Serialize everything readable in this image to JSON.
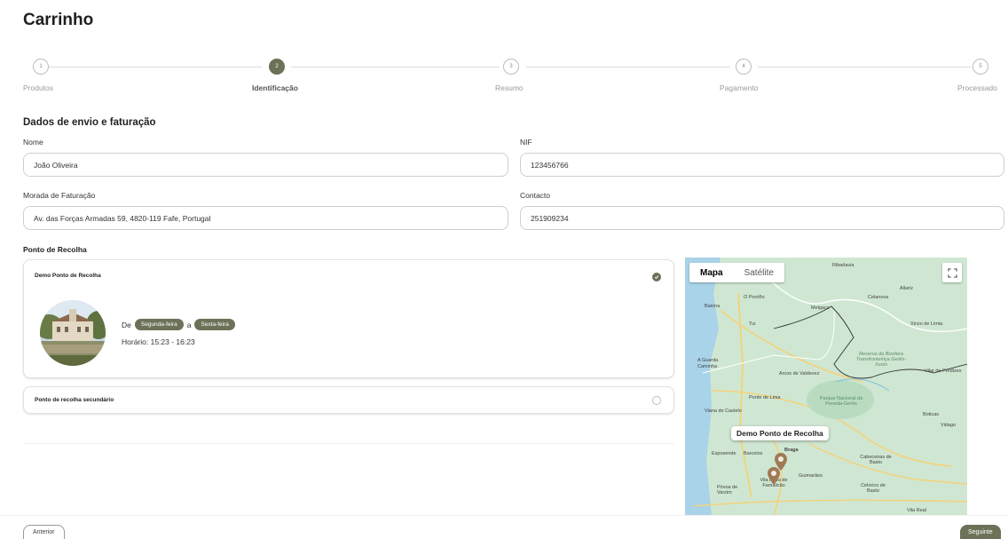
{
  "page": {
    "title": "Carrinho"
  },
  "stepper": {
    "steps": [
      {
        "number": "1",
        "label": "Produtos"
      },
      {
        "number": "2",
        "label": "Identificação"
      },
      {
        "number": "3",
        "label": "Resumo"
      },
      {
        "number": "4",
        "label": "Pagamento"
      },
      {
        "number": "5",
        "label": "Processado"
      }
    ],
    "active_step": 2
  },
  "form": {
    "section_title": "Dados de envio e faturação",
    "name": {
      "label": "Nome",
      "value": "João Oliveira"
    },
    "nif": {
      "label": "NIF",
      "value": "123456766"
    },
    "address": {
      "label": "Morada de Faturação",
      "value": "Av. das Forças Armadas 59, 4820-119 Fafe, Portugal"
    },
    "contact": {
      "label": "Contacto",
      "value": "251909234"
    }
  },
  "pickup": {
    "title": "Ponto de Recolha",
    "points": [
      {
        "name": "Demo Ponto de Recolha",
        "selected": true,
        "from_word": "De",
        "from_day": "Segunda-feira",
        "to_word": "a",
        "to_day": "Sexta-feira",
        "hours": "Horário: 15:23 - 16:23"
      },
      {
        "name": "Ponto de recolha secundário",
        "selected": false
      }
    ]
  },
  "map": {
    "tabs": [
      "Mapa",
      "Satélite"
    ],
    "active_tab": "Mapa",
    "popup": "Demo Ponto de Recolha",
    "places": [
      "Ribadavia",
      "O Porriño",
      "Baiona",
      "Melgaço",
      "Celanova",
      "Allariz",
      "Xinzo de Limia",
      "Tui",
      "A Guarda",
      "Caminha",
      "Arcos de Valdevez",
      "Reserva da Biosfera Transfronteiriça Gerês-Xurés",
      "Vilar de Perdizes",
      "Ponte de Lima",
      "Viana do Castelo",
      "Parque Nacional da Peneda-Gerês",
      "Boticas",
      "Vidago",
      "Esposende",
      "Barcelos",
      "Braga",
      "Cabeceiras de Basto",
      "Póvoa de Varzim",
      "Vila Nova de Famalicão",
      "Guimarães",
      "Celorico de Basto",
      "Vila Real"
    ],
    "colors": {
      "land": "#cfe7d2",
      "water": "#a9d3e8",
      "road": "#f4d27a",
      "marker": "#a07a55"
    }
  },
  "footer": {
    "prev_label": "Anterior",
    "next_label": "Seguinte"
  },
  "colors": {
    "accent": "#6b7257"
  }
}
